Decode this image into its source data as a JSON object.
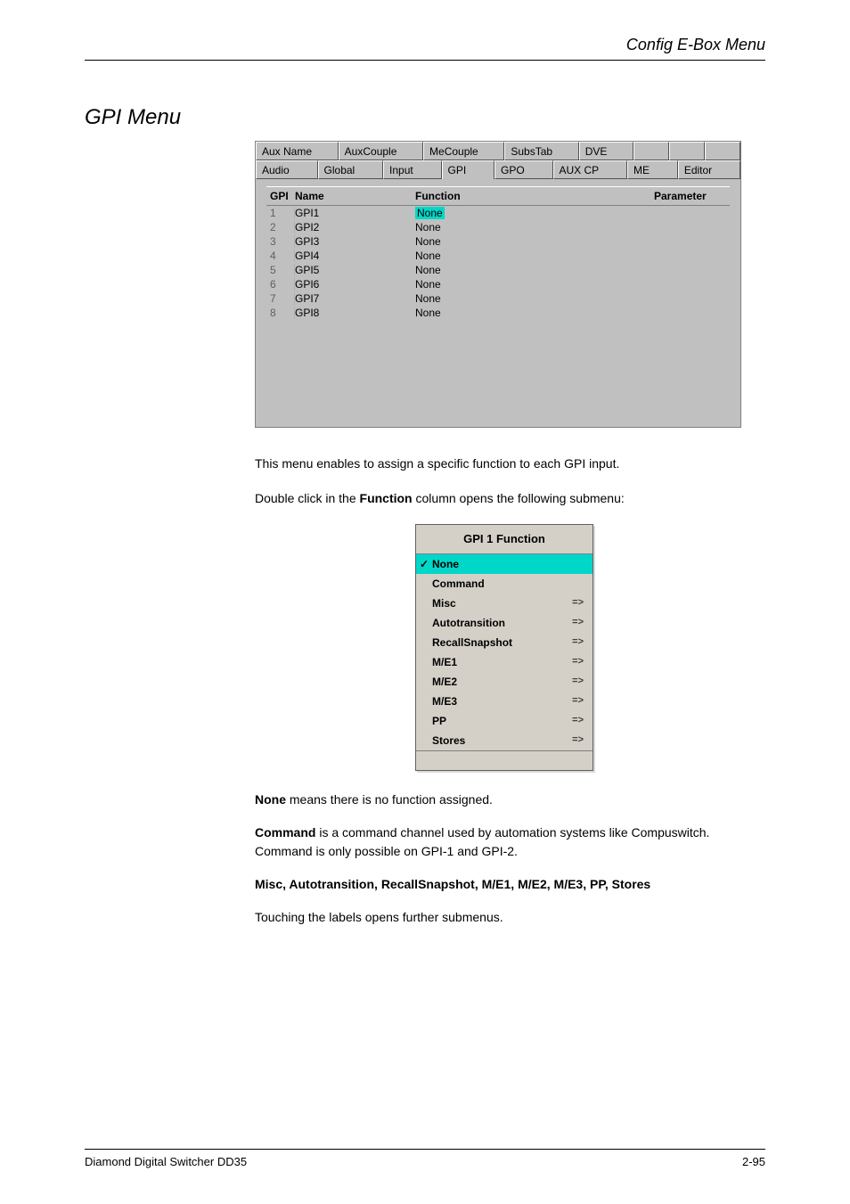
{
  "header": {
    "right": "Config E-Box Menu"
  },
  "section_title": "GPI Menu",
  "tabs_row1": [
    "Aux Name",
    "AuxCouple",
    "MeCouple",
    "SubsTab",
    "DVE",
    "",
    "",
    ""
  ],
  "tabs_row2": [
    "Audio",
    "Global",
    "Input",
    "GPI",
    "GPO",
    "AUX CP",
    "ME",
    "Editor"
  ],
  "active_tab": "GPI",
  "table": {
    "headers": {
      "gpi": "GPI",
      "name": "Name",
      "func": "Function",
      "param": "Parameter"
    },
    "rows": [
      {
        "gpi": "1",
        "name": "GPI1",
        "func": "None",
        "selected": true
      },
      {
        "gpi": "2",
        "name": "GPI2",
        "func": "None",
        "selected": false
      },
      {
        "gpi": "3",
        "name": "GPI3",
        "func": "None",
        "selected": false
      },
      {
        "gpi": "4",
        "name": "GPI4",
        "func": "None",
        "selected": false
      },
      {
        "gpi": "5",
        "name": "GPI5",
        "func": "None",
        "selected": false
      },
      {
        "gpi": "6",
        "name": "GPI6",
        "func": "None",
        "selected": false
      },
      {
        "gpi": "7",
        "name": "GPI7",
        "func": "None",
        "selected": false
      },
      {
        "gpi": "8",
        "name": "GPI8",
        "func": "None",
        "selected": false
      }
    ]
  },
  "text": {
    "p1": "This menu enables to assign a specific function to each GPI input.",
    "p2_prefix": "Double click in the ",
    "p2_function": "Function",
    "p2_suffix": " column opens the following submenu:",
    "p3_lead": "None",
    "p3_body": " means there is no function assigned.",
    "p4_lead": "Command",
    "p4_body": " is a command channel used by automation systems like Compuswitch. Command is only possible on GPI-1 and GPI-2.",
    "p5": "Misc, Autotransition, RecallSnapshot, M/E1, M/E2, M/E3, PP, Stores",
    "p6": "Touching the labels opens further submenus."
  },
  "submenu": {
    "title": "GPI 1  Function",
    "items": [
      {
        "label": "None",
        "selected": true,
        "arrow": false
      },
      {
        "label": "Command",
        "selected": false,
        "arrow": false
      },
      {
        "label": "Misc",
        "selected": false,
        "arrow": true
      },
      {
        "label": "Autotransition",
        "selected": false,
        "arrow": true
      },
      {
        "label": "RecallSnapshot",
        "selected": false,
        "arrow": true
      },
      {
        "label": "M/E1",
        "selected": false,
        "arrow": true
      },
      {
        "label": "M/E2",
        "selected": false,
        "arrow": true
      },
      {
        "label": "M/E3",
        "selected": false,
        "arrow": true
      },
      {
        "label": "PP",
        "selected": false,
        "arrow": true
      },
      {
        "label": "Stores",
        "selected": false,
        "arrow": true
      }
    ]
  },
  "footer": {
    "left": "Diamond Digital Switcher DD35",
    "right": "2-95"
  }
}
